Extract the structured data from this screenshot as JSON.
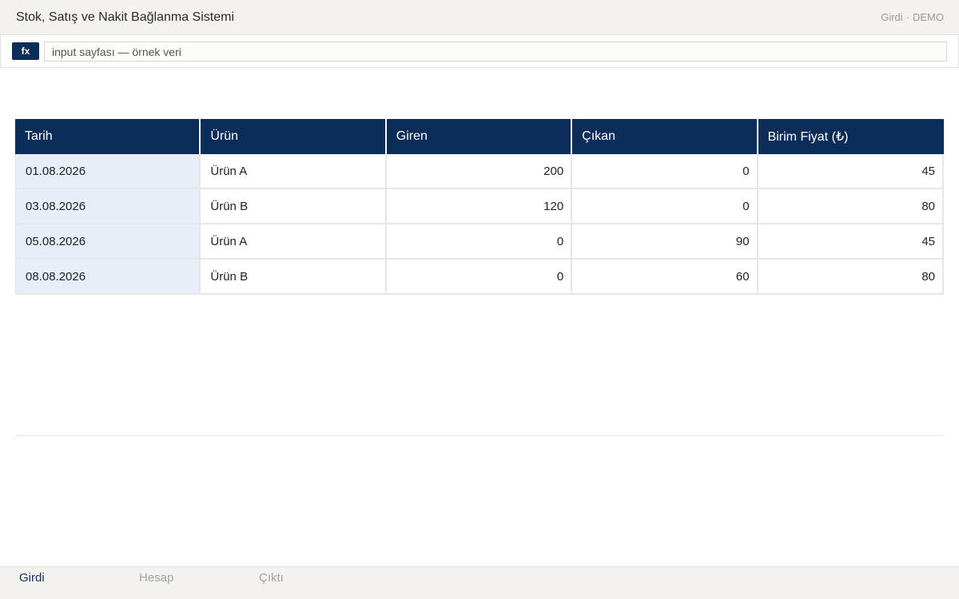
{
  "app": {
    "title": "Stok, Satış ve Nakit Bağlanma Sistemi",
    "sheet_indicator": {
      "sheet": "Girdi",
      "separator": "·",
      "mode": "DEMO"
    }
  },
  "formula_bar": {
    "fx_label": "fx",
    "value": "input sayfası — örnek veri"
  },
  "table": {
    "columns": [
      "Tarih",
      "Ürün",
      "Giren",
      "Çıkan",
      "Birim Fiyat (₺)"
    ],
    "rows": [
      [
        "01.08.2026",
        "Ürün A",
        "200",
        "0",
        "45"
      ],
      [
        "03.08.2026",
        "Ürün B",
        "120",
        "0",
        "80"
      ],
      [
        "05.08.2026",
        "Ürün A",
        "0",
        "90",
        "45"
      ],
      [
        "08.08.2026",
        "Ürün B",
        "0",
        "60",
        "80"
      ]
    ]
  },
  "tabs": {
    "items": [
      "Girdi",
      "Hesap",
      "Çıktı"
    ],
    "active": "Girdi"
  },
  "colors": {
    "accent": "#0c2d57",
    "first_column_fill": "#e8eef8",
    "chrome_background": "#f3f2ee"
  }
}
